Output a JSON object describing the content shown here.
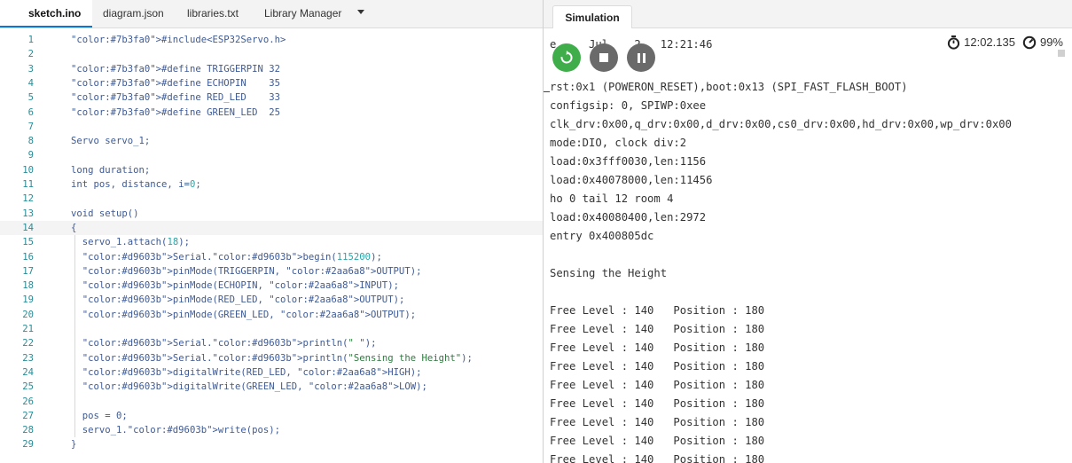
{
  "editor": {
    "tabs": [
      {
        "label": "sketch.ino",
        "active": true
      },
      {
        "label": "diagram.json",
        "active": false
      },
      {
        "label": "libraries.txt",
        "active": false
      },
      {
        "label": "Library Manager",
        "active": false
      }
    ],
    "current_line": 14,
    "code_lines": [
      {
        "n": "1",
        "text": "#include<ESP32Servo.h>"
      },
      {
        "n": "2",
        "text": ""
      },
      {
        "n": "3",
        "text": "#define TRIGGERPIN 32"
      },
      {
        "n": "4",
        "text": "#define ECHOPIN    35"
      },
      {
        "n": "5",
        "text": "#define RED_LED    33"
      },
      {
        "n": "6",
        "text": "#define GREEN_LED  25"
      },
      {
        "n": "7",
        "text": ""
      },
      {
        "n": "8",
        "text": "Servo servo_1;"
      },
      {
        "n": "9",
        "text": ""
      },
      {
        "n": "10",
        "text": "long duration;"
      },
      {
        "n": "11",
        "text": "int pos, distance, i=0;"
      },
      {
        "n": "12",
        "text": ""
      },
      {
        "n": "13",
        "text": "void setup()"
      },
      {
        "n": "14",
        "text": "{"
      },
      {
        "n": "15",
        "text": "  servo_1.attach(18);"
      },
      {
        "n": "16",
        "text": "  Serial.begin(115200);"
      },
      {
        "n": "17",
        "text": "  pinMode(TRIGGERPIN, OUTPUT);"
      },
      {
        "n": "18",
        "text": "  pinMode(ECHOPIN, INPUT);"
      },
      {
        "n": "19",
        "text": "  pinMode(RED_LED, OUTPUT);"
      },
      {
        "n": "20",
        "text": "  pinMode(GREEN_LED, OUTPUT);"
      },
      {
        "n": "21",
        "text": ""
      },
      {
        "n": "22",
        "text": "  Serial.println(\" \");"
      },
      {
        "n": "23",
        "text": "  Serial.println(\"Sensing the Height\");"
      },
      {
        "n": "24",
        "text": "  digitalWrite(RED_LED, HIGH);"
      },
      {
        "n": "25",
        "text": "  digitalWrite(GREEN_LED, LOW);"
      },
      {
        "n": "26",
        "text": ""
      },
      {
        "n": "27",
        "text": "  pos = 0;"
      },
      {
        "n": "28",
        "text": "  servo_1.write(pos);"
      },
      {
        "n": "29",
        "text": "}"
      }
    ]
  },
  "simulation": {
    "tab_label": "Simulation",
    "elapsed_time": "12:02.135",
    "speed": "99%",
    "serial_header": "e     Jul    2   12:21:46",
    "serial_lines": [
      "rst:0x1 (POWERON_RESET),boot:0x13 (SPI_FAST_FLASH_BOOT)",
      "configsip: 0, SPIWP:0xee",
      "clk_drv:0x00,q_drv:0x00,d_drv:0x00,cs0_drv:0x00,hd_drv:0x00,wp_drv:0x00",
      "mode:DIO, clock div:2",
      "load:0x3fff0030,len:1156",
      "load:0x40078000,len:11456",
      "ho 0 tail 12 room 4",
      "load:0x40080400,len:2972",
      "entry 0x400805dc",
      "",
      "Sensing the Height",
      "",
      "Free Level : 140   Position : 180",
      "Free Level : 140   Position : 180",
      "Free Level : 140   Position : 180",
      "Free Level : 140   Position : 180",
      "Free Level : 140   Position : 180",
      "Free Level : 140   Position : 180",
      "Free Level : 140   Position : 180",
      "Free Level : 140   Position : 180",
      "Free Level : 140   Position : 180"
    ]
  },
  "colors": {
    "restart": "#3fae4a",
    "control": "#6a6a6a",
    "keyword": "#7b3fa0",
    "function": "#d9603b",
    "constant": "#2aa6a8"
  },
  "icons": [
    "restart-icon",
    "stop-icon",
    "pause-icon",
    "stopwatch-icon",
    "speed-gauge-icon",
    "chevron-down-icon"
  ]
}
